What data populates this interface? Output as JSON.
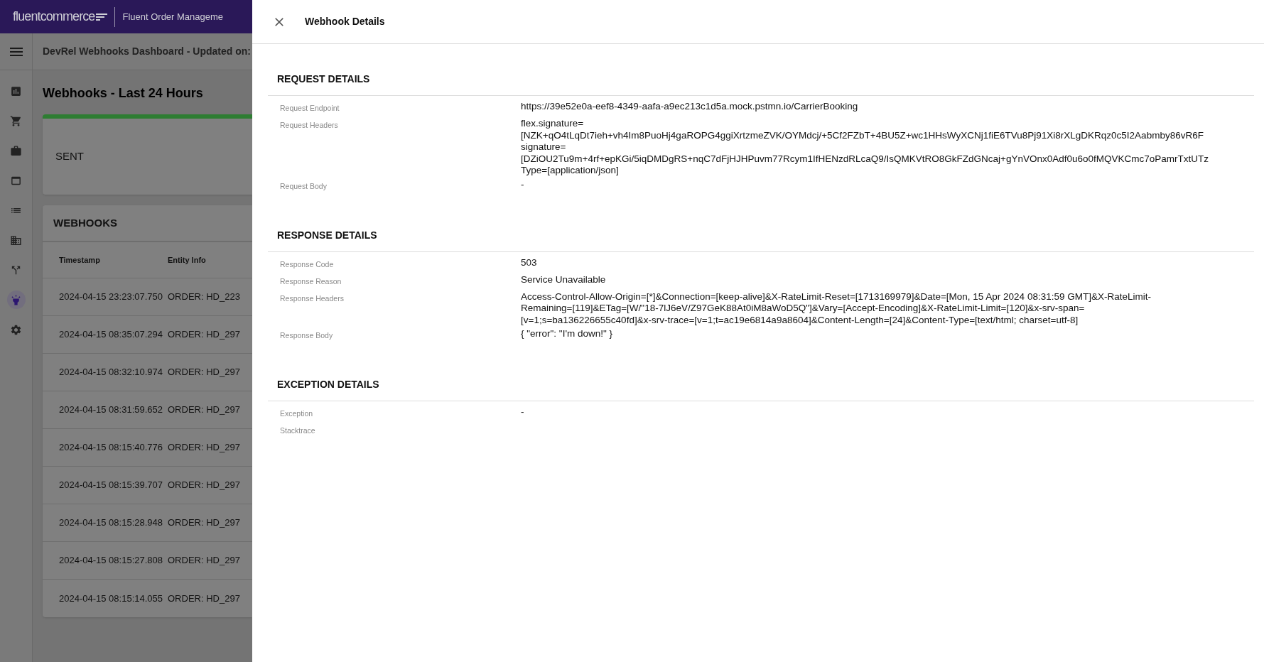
{
  "app_bar": {
    "logo": "fluentcommerce",
    "app_name": "Fluent Order Manageme"
  },
  "sub_header": {
    "title": "DevRel Webhooks Dashboard - Updated on:"
  },
  "sidebar": {
    "items": [
      {
        "kind": "chart",
        "selected": false
      },
      {
        "kind": "cart",
        "selected": false
      },
      {
        "kind": "case",
        "selected": false
      },
      {
        "kind": "web",
        "selected": false
      },
      {
        "kind": "list",
        "selected": false
      },
      {
        "kind": "building",
        "selected": false
      },
      {
        "kind": "split",
        "selected": false
      },
      {
        "kind": "lamp",
        "selected": true
      },
      {
        "kind": "settings",
        "selected": false
      }
    ]
  },
  "page_title": "Webhooks - Last 24 Hours",
  "stat_card": {
    "label": "SENT",
    "color": "#2e7d32"
  },
  "webhooks_table": {
    "title": "WEBHOOKS",
    "columns": [
      "Timestamp",
      "Entity Info"
    ],
    "rows": [
      [
        "2024-04-15 23:23:07.750",
        "ORDER: HD_223"
      ],
      [
        "2024-04-15 08:35:07.294",
        "ORDER: HD_297"
      ],
      [
        "2024-04-15 08:32:10.974",
        "ORDER: HD_297"
      ],
      [
        "2024-04-15 08:31:59.652",
        "ORDER: HD_297"
      ],
      [
        "2024-04-15 08:15:40.776",
        "ORDER: HD_297"
      ],
      [
        "2024-04-15 08:15:39.707",
        "ORDER: HD_297"
      ],
      [
        "2024-04-15 08:15:28.948",
        "ORDER: HD_297"
      ],
      [
        "2024-04-15 08:15:27.808",
        "ORDER: HD_297"
      ],
      [
        "2024-04-15 08:15:14.055",
        "ORDER: HD_297"
      ]
    ]
  },
  "drawer": {
    "title": "Webhook Details",
    "sections": [
      {
        "title": "REQUEST DETAILS",
        "rows": [
          {
            "label": "Request Endpoint",
            "lines": [
              "https://39e52e0a-eef8-4349-aafa-a9ec213c1d5a.mock.pstmn.io/CarrierBooking"
            ]
          },
          {
            "label": "Request Headers",
            "lines": [
              "flex.signature=",
              "[NZK+qO4tLqDt7ieh+vh4Im8PuoHj4gaROPG4ggiXrtzmeZVK/OYMdcj/+5Cf2FZbT+4BU5Z+wc1HHsWyXCNj1fiE6TVu8Pj91Xi8rXLgDKRqz0c5I2Aabmby86vR6F",
              "signature=",
              "[DZiOU2Tu9m+4rf+epKGi/5iqDMDgRS+nqC7dFjHJHPuvm77Rcym1IfHENzdRLcaQ9/IsQMKVtRO8GkFZdGNcaj+gYnVOnx0Adf0u6o0fMQVKCmc7oPamrTxtUTz",
              "Type=[application/json]"
            ]
          },
          {
            "label": "Request Body",
            "lines": [
              "-"
            ]
          }
        ]
      },
      {
        "title": "RESPONSE DETAILS",
        "rows": [
          {
            "label": "Response Code",
            "lines": [
              "503"
            ]
          },
          {
            "label": "Response Reason",
            "lines": [
              "Service Unavailable"
            ]
          },
          {
            "label": "Response Headers",
            "lines": [
              "Access-Control-Allow-Origin=[*]&Connection=[keep-alive]&X-RateLimit-Reset=[1713169979]&Date=[Mon, 15 Apr 2024 08:31:59 GMT]&X-RateLimit-",
              "Remaining=[119]&ETag=[W/\"18-7lJ6eV/Z97GeK88At0iM8aWoD5Q\"]&Vary=[Accept-Encoding]&X-RateLimit-Limit=[120]&x-srv-span=",
              "[v=1;s=ba136226655c40fd]&x-srv-trace=[v=1;t=ac19e6814a9a8604]&Content-Length=[24]&Content-Type=[text/html; charset=utf-8]"
            ]
          },
          {
            "label": "Response Body",
            "lines": [
              "{ \"error\": \"I'm down!\" }"
            ]
          }
        ]
      },
      {
        "title": "EXCEPTION DETAILS",
        "rows": [
          {
            "label": "Exception",
            "lines": [
              "-"
            ]
          },
          {
            "label": "Stacktrace"
          }
        ]
      }
    ]
  }
}
